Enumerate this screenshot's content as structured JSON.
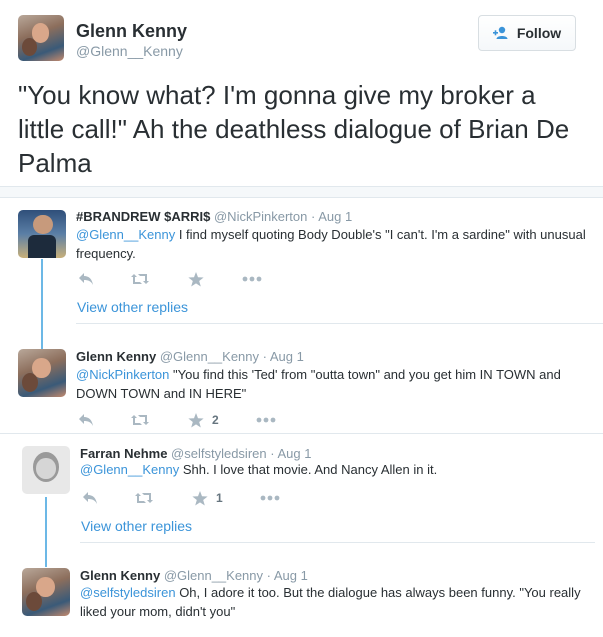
{
  "header": {
    "name": "Glenn Kenny",
    "handle": "@Glenn__Kenny",
    "follow_label": "Follow",
    "avatar_icon": "profile-photo"
  },
  "main_tweet": {
    "text": "\"You know what? I'm gonna give my broker a little call!\" Ah the deathless dialogue of Brian De Palma"
  },
  "replies": [
    {
      "name": "#BRANDREW $ARRI$",
      "handle": "@NickPinkerton",
      "time": "· Aug 1",
      "mention": "@Glenn__Kenny",
      "text": " I find myself quoting Body Double's \"I can't. I'm a sardine\" with unusual frequency.",
      "fav_count": "",
      "view_other": "View other replies"
    },
    {
      "name": "Glenn Kenny",
      "handle": "@Glenn__Kenny",
      "time": "· Aug 1",
      "mention": "@NickPinkerton",
      "text": " \"You find this 'Ted' from \"outta town\" and you get him IN TOWN and DOWN TOWN and IN HERE\"",
      "fav_count": "2"
    },
    {
      "name": "Farran Nehme",
      "handle": "@selfstyledsiren",
      "time": "· Aug 1",
      "mention": "@Glenn__Kenny",
      "text": " Shh. I love that movie. And Nancy Allen in it.",
      "fav_count": "1",
      "view_other": "View other replies"
    },
    {
      "name": "Glenn Kenny",
      "handle": "@Glenn__Kenny",
      "time": "· Aug 1",
      "mention": "@selfstyledsiren",
      "text": " Oh, I adore it too. But the dialogue has always been funny. \"You really liked your mom, didn't you\""
    }
  ],
  "colors": {
    "link": "#3b94d9",
    "muted": "#8899a6",
    "icon": "#aab8c2",
    "thread": "#6cb8e6"
  }
}
